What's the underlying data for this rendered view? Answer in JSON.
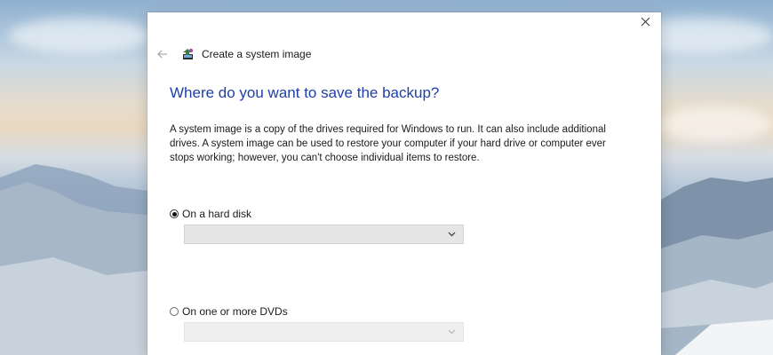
{
  "window": {
    "title": "Create a system image",
    "close_glyph": "✕",
    "back_glyph": "←"
  },
  "main": {
    "heading": "Where do you want to save the backup?",
    "description": "A system image is a copy of the drives required for Windows to run. It can also include additional drives. A system image can be used to restore your computer if your hard drive or computer ever stops working; however, you can't choose individual items to restore.",
    "options": [
      {
        "label": "On a hard disk",
        "selected": true,
        "dropdown_value": "",
        "dropdown_enabled": true
      },
      {
        "label": "On one or more DVDs",
        "selected": false,
        "dropdown_value": "",
        "dropdown_enabled": false
      }
    ]
  },
  "icons": {
    "back": "arrow-left-icon",
    "app": "backup-icon",
    "close": "close-icon",
    "dropdown": "chevron-down-icon"
  },
  "colors": {
    "heading": "#1f3fa8",
    "window_bg": "#ffffff",
    "select_bg": "#e5e5e5"
  }
}
